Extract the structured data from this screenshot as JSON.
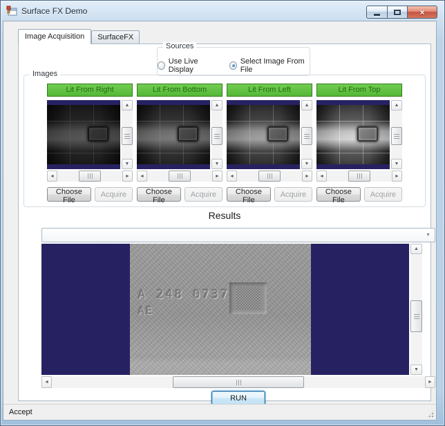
{
  "window": {
    "title": "Surface FX Demo"
  },
  "icons": {
    "close": "×",
    "dropdown_arrow": "▼",
    "scroll_up": "▲",
    "scroll_down": "▼",
    "scroll_left": "◄",
    "scroll_right": "►"
  },
  "tabs": {
    "image_acquisition": "Image Acquisition",
    "surfacefx": "SurfaceFX"
  },
  "sources": {
    "legend": "Sources",
    "live_option": "Use Live Display",
    "file_option": "Select Image From File",
    "selected_option": "Select Image From File"
  },
  "images": {
    "legend": "Images",
    "panels": [
      {
        "title": "Lit From Right"
      },
      {
        "title": "Lit From Bottom"
      },
      {
        "title": "Lit From Left"
      },
      {
        "title": "Lit From Top"
      }
    ],
    "choose_file_label": "Choose File",
    "acquire_label": "Acquire"
  },
  "results": {
    "heading": "Results",
    "combo_value": "",
    "stamp_line1": "A 248 0737",
    "stamp_line2": "AE",
    "run_label": "RUN"
  },
  "statusbar": {
    "text": "Accept"
  },
  "colors": {
    "header_green": "#5cbe3e",
    "navy": "#262262",
    "focus_blue": "#3f9bcd",
    "frame_blue": "#bdd3e8"
  }
}
